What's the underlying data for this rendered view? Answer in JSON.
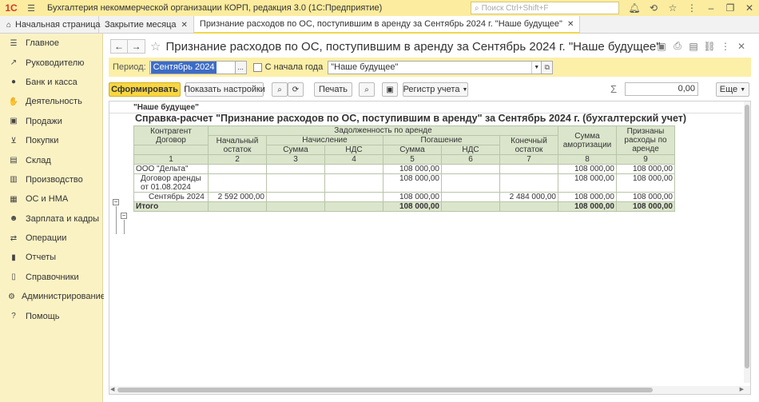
{
  "titlebar": {
    "logo": "1С",
    "app_title": "Бухгалтерия некоммерческой организации КОРП, редакция 3.0  (1С:Предприятие)",
    "search_placeholder": "Поиск Ctrl+Shift+F"
  },
  "tabs": [
    {
      "label": "Начальная страница"
    },
    {
      "label": "Закрытие месяца"
    },
    {
      "label": "Признание расходов по ОС, поступившим в аренду за Сентябрь 2024 г. \"Наше будущее\""
    }
  ],
  "sidebar": {
    "items": [
      {
        "label": "Главное",
        "icon": "menu-icon"
      },
      {
        "label": "Руководителю",
        "icon": "chart-icon"
      },
      {
        "label": "Банк и касса",
        "icon": "coin-icon"
      },
      {
        "label": "Деятельность",
        "icon": "activity-icon"
      },
      {
        "label": "Продажи",
        "icon": "cart-icon"
      },
      {
        "label": "Покупки",
        "icon": "basket-icon"
      },
      {
        "label": "Склад",
        "icon": "box-icon"
      },
      {
        "label": "Производство",
        "icon": "factory-icon"
      },
      {
        "label": "ОС и НМА",
        "icon": "assets-icon"
      },
      {
        "label": "Зарплата и кадры",
        "icon": "person-icon"
      },
      {
        "label": "Операции",
        "icon": "operations-icon"
      },
      {
        "label": "Отчеты",
        "icon": "reports-icon"
      },
      {
        "label": "Справочники",
        "icon": "book-icon"
      },
      {
        "label": "Администрирование",
        "icon": "gear-icon"
      },
      {
        "label": "Помощь",
        "icon": "help-icon"
      }
    ]
  },
  "page": {
    "title": "Признание расходов по ОС, поступившим в аренду за Сентябрь 2024 г. \"Наше будущее\""
  },
  "period_bar": {
    "period_label": "Период:",
    "period_value": "Сентябрь 2024",
    "from_year_label": "С начала года",
    "organization": "\"Наше будущее\""
  },
  "toolbar": {
    "generate_label": "Сформировать",
    "settings_label": "Показать настройки",
    "print_label": "Печать",
    "register_label": "Регистр учета",
    "sum_value": "0,00",
    "more_label": "Еще"
  },
  "report": {
    "org": "\"Наше будущее\"",
    "title": "Справка-расчет \"Признание расходов по ОС, поступившим в аренду\" за Сентябрь 2024 г. (бухгалтерский учет)",
    "headers": {
      "counterparty": "Контрагент",
      "contract": "Договор",
      "debt": "Задолженность по аренде",
      "opening": "Начальный остаток",
      "accrual": "Начисление",
      "repayment": "Погашение",
      "closing": "Конечный остаток",
      "sum": "Сумма",
      "vat": "НДС",
      "amort": "Сумма амортизации",
      "recognized": "Признаны расходы по аренде",
      "nums": [
        "1",
        "2",
        "3",
        "4",
        "5",
        "6",
        "7",
        "8",
        "9"
      ]
    },
    "rows": [
      {
        "name": "ООО \"Дельта\"",
        "opening": "",
        "acc_sum": "",
        "acc_vat": "",
        "rep_sum": "108 000,00",
        "rep_vat": "",
        "closing": "",
        "amort": "108 000,00",
        "recog": "108 000,00"
      },
      {
        "name": "Договор аренды от 01.08.2024",
        "opening": "",
        "acc_sum": "",
        "acc_vat": "",
        "rep_sum": "108 000,00",
        "rep_vat": "",
        "closing": "",
        "amort": "108 000,00",
        "recog": "108 000,00"
      },
      {
        "name": "Сентябрь 2024",
        "opening": "2 592 000,00",
        "acc_sum": "",
        "acc_vat": "",
        "rep_sum": "108 000,00",
        "rep_vat": "",
        "closing": "2 484 000,00",
        "amort": "108 000,00",
        "recog": "108 000,00"
      }
    ],
    "total": {
      "name": "Итого",
      "rep_sum": "108 000,00",
      "amort": "108 000,00",
      "recog": "108 000,00"
    }
  }
}
